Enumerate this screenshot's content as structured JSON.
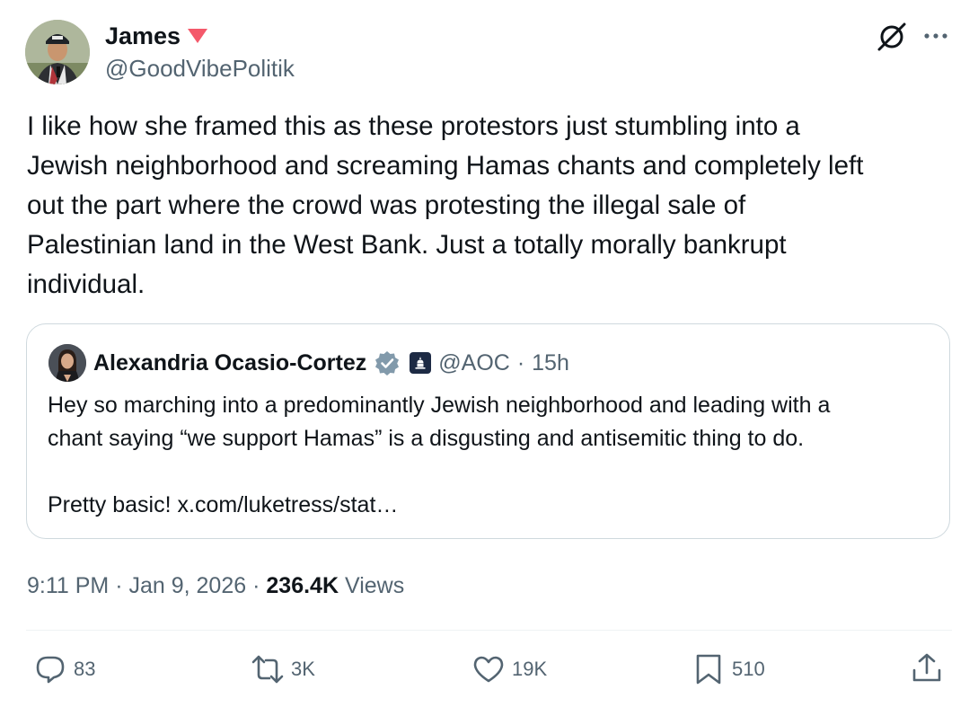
{
  "author": {
    "display_name": "James",
    "handle": "@GoodVibePolitik",
    "name_emoji": "red-triangle-down"
  },
  "tweet": {
    "text": "I like how she framed this as these protestors just stumbling into a\nJewish neighborhood and screaming Hamas chants and completely left\nout the part where the crowd was protesting the illegal sale of\nPalestinian land in the West Bank. Just a totally morally bankrupt\nindividual.",
    "time": "9:11 PM",
    "date": "Jan 9, 2026",
    "separator": "·",
    "views_count": "236.4K",
    "views_label": "Views"
  },
  "quote": {
    "display_name": "Alexandria Ocasio-Cortez",
    "handle": "@AOC",
    "separator": "·",
    "time": "15h",
    "text": "Hey so marching into a predominantly Jewish neighborhood and leading with a\nchant saying “we support Hamas” is a disgusting and antisemitic thing to do.\n\nPretty basic! x.com/luketress/stat…"
  },
  "actions": {
    "replies": "83",
    "reposts": "3K",
    "likes": "19K",
    "bookmarks": "510"
  },
  "icons": [
    "grok-icon",
    "more-icon",
    "verified-icon",
    "government-badge-icon",
    "reply-icon",
    "repost-icon",
    "like-icon",
    "bookmark-icon",
    "share-icon"
  ],
  "colors": {
    "text": "#0f1419",
    "secondary": "#536471",
    "border": "#cfd9de",
    "emoji_red": "#f4596b",
    "verified_gray": "#829aab"
  }
}
